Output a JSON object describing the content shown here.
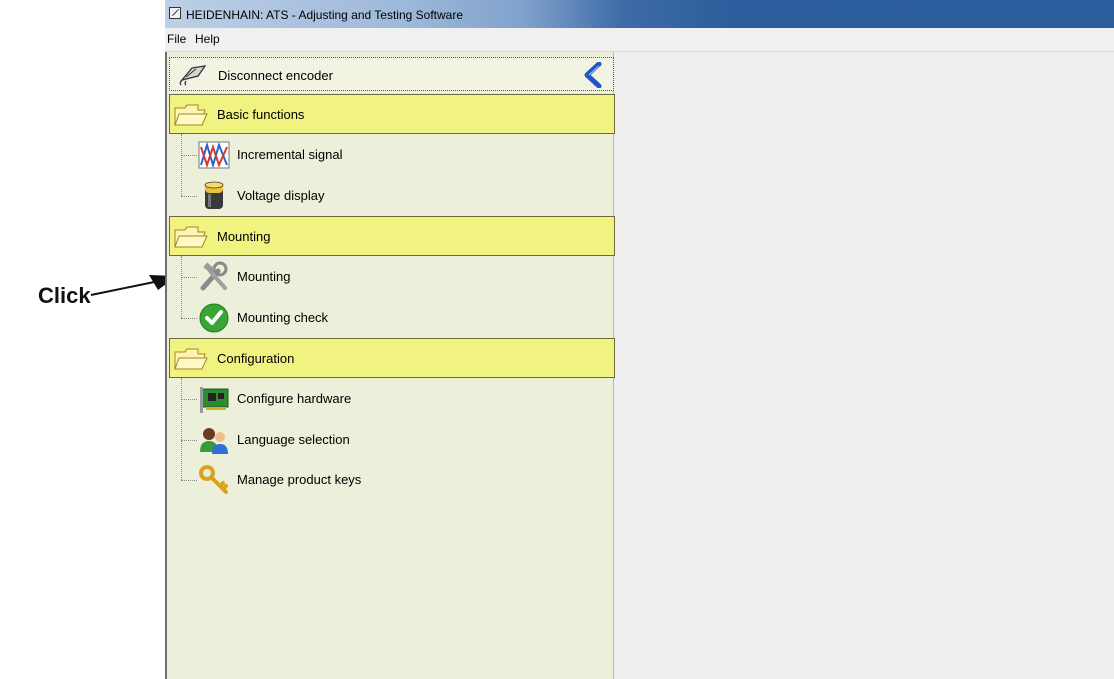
{
  "annotation": {
    "text": "Click"
  },
  "window": {
    "title": "HEIDENHAIN: ATS - Adjusting and Testing Software"
  },
  "menu": {
    "file": "File",
    "help": "Help"
  },
  "nav": {
    "disconnect": {
      "label": "Disconnect encoder",
      "icon": "encoder-plug-icon",
      "collapse_icon": "chevron-left-icon"
    },
    "groups": [
      {
        "label": "Basic functions",
        "icon": "folder-icon",
        "items": [
          {
            "label": "Incremental signal",
            "icon": "signal-graph-icon"
          },
          {
            "label": "Voltage display",
            "icon": "battery-icon"
          }
        ]
      },
      {
        "label": "Mounting",
        "icon": "folder-icon",
        "items": [
          {
            "label": "Mounting",
            "icon": "tools-icon"
          },
          {
            "label": "Mounting check",
            "icon": "check-circle-icon"
          }
        ]
      },
      {
        "label": "Configuration",
        "icon": "folder-icon",
        "items": [
          {
            "label": "Configure hardware",
            "icon": "pci-card-icon"
          },
          {
            "label": "Language selection",
            "icon": "users-icon"
          },
          {
            "label": "Manage product keys",
            "icon": "keys-icon"
          }
        ]
      }
    ]
  },
  "colors": {
    "folder_bg": "#f0f37f",
    "panel_bg": "#ecefd9",
    "titlebar": "#2b5d9c",
    "accent_blue": "#2f6fd6"
  }
}
